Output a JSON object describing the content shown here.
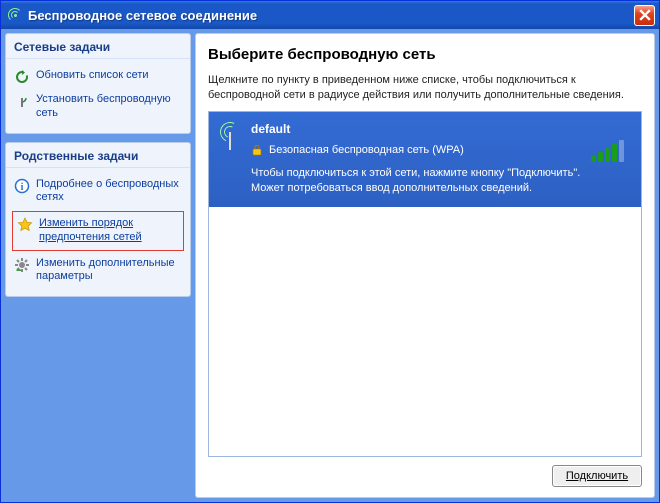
{
  "titlebar": {
    "title": "Беспроводное сетевое соединение"
  },
  "sidebar": {
    "panel1": {
      "heading": "Сетевые задачи",
      "tasks": {
        "refresh": "Обновить список сети",
        "setup": "Установить беспроводную сеть"
      }
    },
    "panel2": {
      "heading": "Родственные задачи",
      "tasks": {
        "learn": "Подробнее о беспроводных сетях",
        "order": "Изменить порядок предпочтения сетей",
        "advanced": "Изменить дополнительные параметры"
      }
    }
  },
  "main": {
    "heading": "Выберите беспроводную сеть",
    "instruction": "Щелкните по пункту в приведенном ниже списке, чтобы подключиться к беспроводной сети в радиусе действия или получить дополнительные сведения.",
    "networks": [
      {
        "name": "default",
        "security": "Безопасная беспроводная сеть (WPA)",
        "hint": "Чтобы подключиться к этой сети, нажмите кнопку \"Подключить\". Может потребоваться ввод дополнительных сведений.",
        "signal_bars": 4,
        "signal_max": 5
      }
    ],
    "connect_button": "Подключить"
  }
}
